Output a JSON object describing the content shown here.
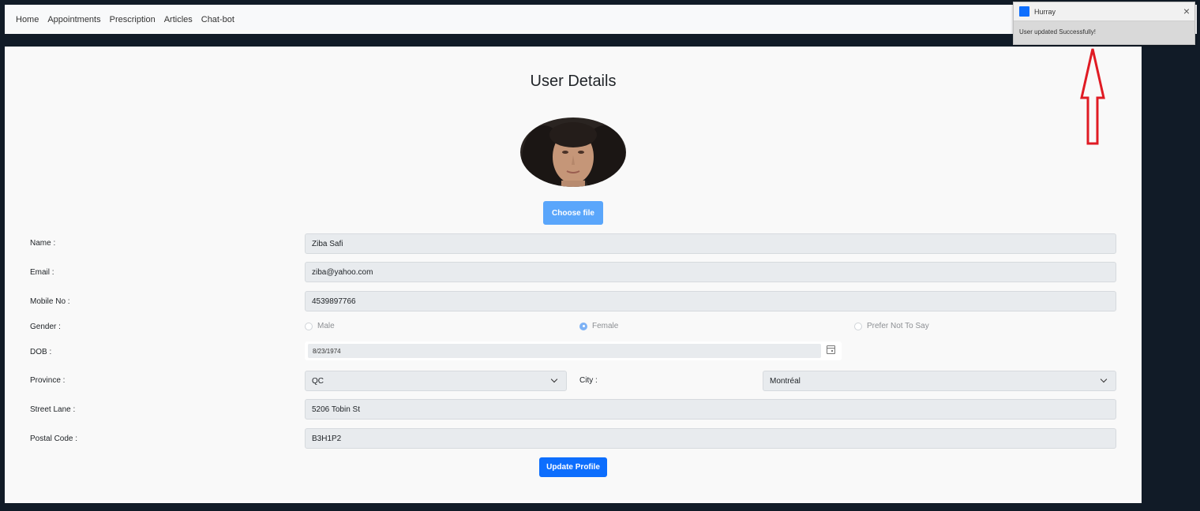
{
  "nav": {
    "items": [
      "Home",
      "Appointments",
      "Prescription",
      "Articles",
      "Chat-bot"
    ]
  },
  "page": {
    "title": "User Details",
    "choose_file_label": "Choose file",
    "update_label": "Update Profile"
  },
  "form": {
    "name_label": "Name :",
    "name_value": "Ziba Safi",
    "email_label": "Email :",
    "email_value": "ziba@yahoo.com",
    "mobile_label": "Mobile No :",
    "mobile_value": "4539897766",
    "gender_label": "Gender :",
    "gender_options": [
      "Male",
      "Female",
      "Prefer Not To Say"
    ],
    "gender_selected": "Female",
    "dob_label": "DOB :",
    "dob_value": "8/23/1974",
    "province_label": "Province :",
    "province_value": "QC",
    "city_label": "City :",
    "city_value": "Montréal",
    "street_label": "Street Lane :",
    "street_value": "5206 Tobin St",
    "postal_label": "Postal Code :",
    "postal_value": "B3H1P2"
  },
  "toast": {
    "title": "Hurray",
    "message": "User updated Successfully!"
  },
  "colors": {
    "primary": "#0d6efd",
    "annotation_arrow": "#e01b24"
  }
}
